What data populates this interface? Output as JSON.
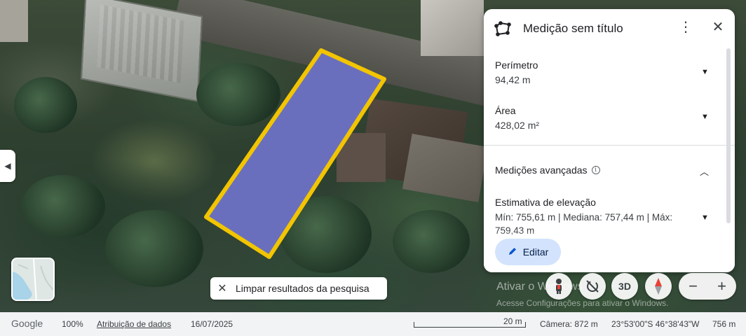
{
  "panel": {
    "title": "Medição sem título",
    "more_glyph": "⋮",
    "close_glyph": "✕",
    "perimeter": {
      "label": "Perímetro",
      "value": "94,42 m"
    },
    "area": {
      "label": "Área",
      "value": "428,02 m²"
    },
    "advanced": {
      "label": "Medições avançadas",
      "info_glyph": "i"
    },
    "elevation": {
      "label": "Estimativa de elevação",
      "value": "Mín: 755,61 m | Mediana: 757,44 m | Máx: 759,43 m"
    },
    "edit_label": "Editar",
    "caret_down": "▼",
    "caret_up": "︿"
  },
  "chip": {
    "close_glyph": "✕",
    "label": "Limpar resultados da pesquisa"
  },
  "controls": {
    "view_3d": "3D",
    "zoom_out": "−",
    "zoom_in": "+"
  },
  "side_toggle_glyph": "◀",
  "watermark": {
    "title": "Ativar o Windows",
    "subtitle": "Acesse Configurações para ativar o Windows."
  },
  "footer": {
    "logo": "Google",
    "zoom": "100%",
    "attribution": "Atribuição de dados",
    "date": "16/07/2025",
    "scale": "20 m",
    "camera": "Câmera: 872 m",
    "coords": "23°53'00\"S 46°38'43\"W",
    "elevation": "756 m"
  },
  "colors": {
    "polygon_fill": "#6a6fbd",
    "polygon_stroke": "#f2c500",
    "accent": "#0b57d0",
    "edit_bg": "#d3e3fd",
    "compass_red": "#e94235"
  },
  "icons": {
    "measure": "polygon-measure-icon",
    "pegman": "pegman-icon",
    "rotate": "rotate-disabled-icon",
    "compass": "compass-icon",
    "pen": "pencil-icon"
  }
}
